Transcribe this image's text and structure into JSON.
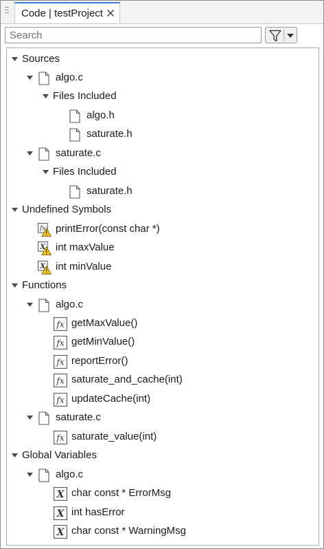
{
  "tab": {
    "title": "Code | testProject"
  },
  "search": {
    "placeholder": "Search"
  },
  "tree": {
    "sources": {
      "label": "Sources",
      "algo_c": {
        "label": "algo.c",
        "files_included": "Files Included",
        "algo_h": "algo.h",
        "saturate_h": "saturate.h"
      },
      "saturate_c": {
        "label": "saturate.c",
        "files_included": "Files Included",
        "saturate_h": "saturate.h"
      }
    },
    "undefined": {
      "label": "Undefined Symbols",
      "items": [
        "printError(const char *)",
        "int maxValue",
        "int minValue"
      ]
    },
    "functions": {
      "label": "Functions",
      "algo_c": {
        "label": "algo.c",
        "items": [
          "getMaxValue()",
          "getMinValue()",
          "reportError()",
          "saturate_and_cache(int)",
          "updateCache(int)"
        ]
      },
      "saturate_c": {
        "label": "saturate.c",
        "items": [
          "saturate_value(int)"
        ]
      }
    },
    "globals": {
      "label": "Global Variables",
      "algo_c": {
        "label": "algo.c",
        "items": [
          "char const * ErrorMsg",
          "int hasError",
          "char const * WarningMsg"
        ]
      }
    }
  }
}
